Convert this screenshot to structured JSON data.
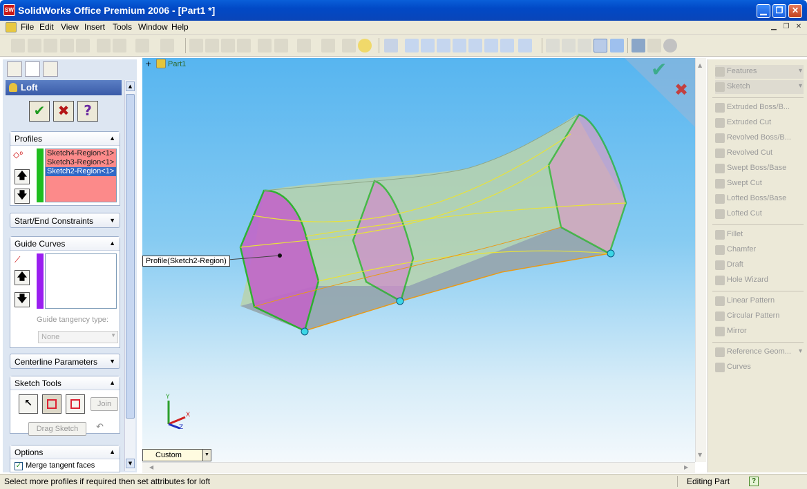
{
  "window": {
    "title": "SolidWorks Office Premium 2006 - [Part1 *]",
    "app_icon_text": "SW",
    "colors": {
      "titlebar": "#0149c6",
      "panel_bg": "#dde6f2",
      "viewport_top": "#57b5f0",
      "profile_face": "#c266c8",
      "surface": "#b4d2a0",
      "edge": "#22b022",
      "guide": "#e8e23a"
    }
  },
  "menu": {
    "items": [
      "File",
      "Edit",
      "View",
      "Insert",
      "Tools",
      "Window",
      "Help"
    ]
  },
  "feature_manager": {
    "header": "Loft",
    "ok_symbol": "✔",
    "cancel_symbol": "✖",
    "help_symbol": "?",
    "profiles": {
      "title": "Profiles",
      "items": [
        "Sketch4-Region<1>",
        "Sketch3-Region<1>",
        "Sketch2-Region<1>"
      ],
      "selected_index": 2
    },
    "start_end_constraints": {
      "title": "Start/End Constraints"
    },
    "guide_curves": {
      "title": "Guide Curves",
      "tangency_label": "Guide tangency type:",
      "tangency_value": "None"
    },
    "centerline": {
      "title": "Centerline Parameters"
    },
    "sketch_tools": {
      "title": "Sketch Tools",
      "join_label": "Join",
      "drag_sketch_label": "Drag Sketch"
    },
    "options": {
      "title": "Options",
      "merge_tangent_label": "Merge tangent faces",
      "merge_tangent_checked": true
    }
  },
  "viewport": {
    "tree_label": "Part1",
    "tree_expand": "+",
    "callout": "Profile(Sketch2-Region)",
    "view_orientation": "Custom",
    "triad": {
      "x": "X",
      "y": "Y",
      "z": "Z"
    },
    "confirm_ok": "✔",
    "confirm_cancel": "✖"
  },
  "command_manager": {
    "groups": [
      [
        "Features",
        "Sketch"
      ],
      [
        "Extruded Boss/B...",
        "Extruded Cut",
        "Revolved Boss/B...",
        "Revolved Cut",
        "Swept Boss/Base",
        "Swept Cut",
        "Lofted Boss/Base",
        "Lofted Cut"
      ],
      [
        "Fillet",
        "Chamfer",
        "Draft",
        "Hole Wizard"
      ],
      [
        "Linear Pattern",
        "Circular Pattern",
        "Mirror"
      ],
      [
        "Reference Geom...",
        "Curves"
      ]
    ]
  },
  "status": {
    "message": "Select more profiles if required then set attributes for loft",
    "mode": "Editing Part",
    "help_symbol": "?"
  }
}
